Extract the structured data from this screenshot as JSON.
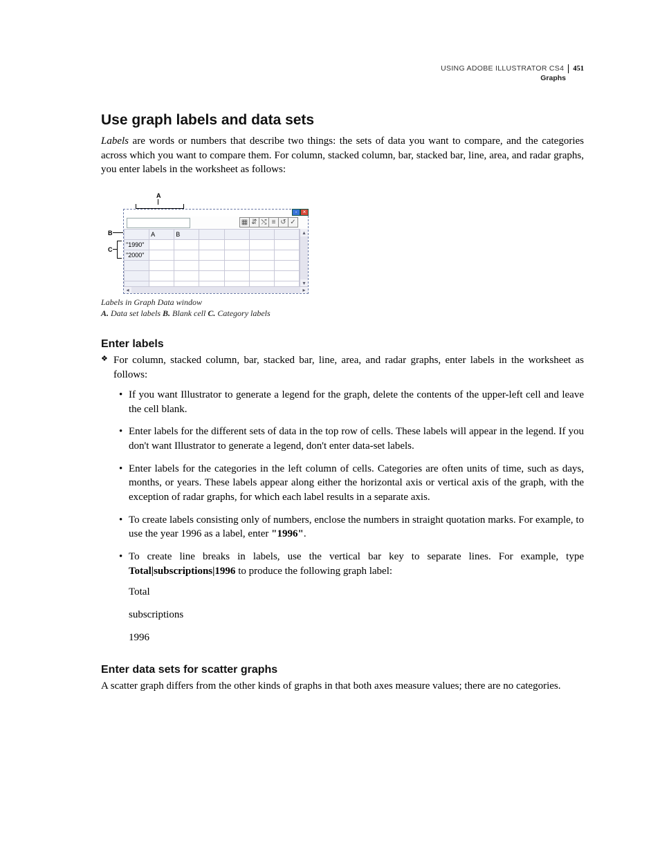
{
  "runhead": {
    "book": "USING ADOBE ILLUSTRATOR CS4",
    "chapter": "Graphs",
    "page": "451"
  },
  "h1": "Use graph labels and data sets",
  "intro_lead_italic": "Labels",
  "intro_rest": " are words or numbers that describe two things: the sets of data you want to compare, and the categories across which you want to compare them. For column, stacked column, bar, stacked bar, line, area, and radar graphs, you enter labels in the worksheet as follows:",
  "figure": {
    "calloutA": "A",
    "calloutB": "B",
    "calloutC": "C",
    "headerA": "A",
    "headerB": "B",
    "row1": "\"1990\"",
    "row2": "\"2000\"",
    "caption_line1": "Labels in Graph Data window",
    "caption_A": "A.",
    "caption_A_txt": " Data set labels  ",
    "caption_B": "B.",
    "caption_B_txt": " Blank cell  ",
    "caption_C": "C.",
    "caption_C_txt": " Category labels"
  },
  "h2a": "Enter labels",
  "enter_labels_lead": "For column, stacked column, bar, stacked bar, line, area, and radar graphs, enter labels in the worksheet as follows:",
  "bullets": {
    "b1": "If you want Illustrator to generate a legend for the graph, delete the contents of the upper-left cell and leave the cell blank.",
    "b2": "Enter labels for the different sets of data in the top row of cells. These labels will appear in the legend. If you don't want Illustrator to generate a legend, don't enter data-set labels.",
    "b3": "Enter labels for the categories in the left column of cells. Categories are often units of time, such as days, months, or years. These labels appear along either the horizontal axis or vertical axis of the graph, with the exception of radar graphs, for which each label results in a separate axis.",
    "b4a": "To create labels consisting only of numbers, enclose the numbers in straight quotation marks. For example, to use the year 1996 as a label, enter ",
    "b4b": "\"1996\"",
    "b4c": ".",
    "b5a": "To create line breaks in labels, use the vertical bar key to separate lines. For example, type ",
    "b5b": "Total|subscriptions|1996",
    "b5c": " to produce the following graph label:",
    "stack1": "Total",
    "stack2": "subscriptions",
    "stack3": "1996"
  },
  "h2b": "Enter data sets for scatter graphs",
  "scatter_body": "A scatter graph differs from the other kinds of graphs in that both axes measure values; there are no categories."
}
